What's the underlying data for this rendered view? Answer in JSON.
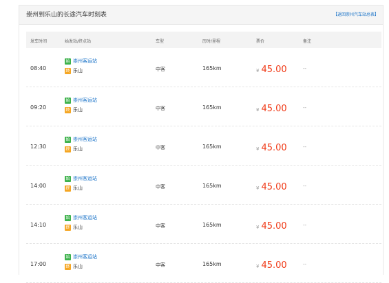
{
  "panel": {
    "title": "崇州到乐山的长途汽车时刻表",
    "back_link": "【返回崇州汽车站总表】"
  },
  "table": {
    "headers": {
      "departure_time": "发车时间",
      "route": "始发站/终点站",
      "vehicle_type": "车型",
      "duration_distance": "历时/里程",
      "price": "票价",
      "remarks": "备注"
    },
    "badges": {
      "start": "始",
      "end": "终"
    },
    "currency_symbol": "¥",
    "rows": [
      {
        "time": "08:40",
        "origin": "崇州客运站",
        "destination": "乐山",
        "type": "中客",
        "distance": "165km",
        "price": "45.00",
        "note": "--"
      },
      {
        "time": "09:20",
        "origin": "崇州客运站",
        "destination": "乐山",
        "type": "中客",
        "distance": "165km",
        "price": "45.00",
        "note": "--"
      },
      {
        "time": "12:30",
        "origin": "崇州客运站",
        "destination": "乐山",
        "type": "中客",
        "distance": "165km",
        "price": "45.00",
        "note": "--"
      },
      {
        "time": "14:00",
        "origin": "崇州客运站",
        "destination": "乐山",
        "type": "中客",
        "distance": "165km",
        "price": "45.00",
        "note": "--"
      },
      {
        "time": "14:10",
        "origin": "崇州客运站",
        "destination": "乐山",
        "type": "中客",
        "distance": "165km",
        "price": "45.00",
        "note": "--"
      },
      {
        "time": "17:00",
        "origin": "崇州客运站",
        "destination": "乐山",
        "type": "中客",
        "distance": "165km",
        "price": "45.00",
        "note": "--"
      }
    ]
  },
  "colors": {
    "link": "#1a73c8",
    "price": "#f03a17",
    "start_badge": "#3db24b",
    "end_badge": "#f5a623"
  }
}
